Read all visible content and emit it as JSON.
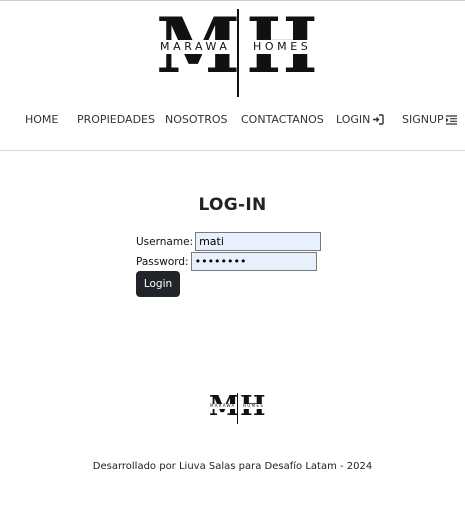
{
  "brand": {
    "monogram_left": "M",
    "monogram_right": "H",
    "word_left": "MARAWA",
    "word_right": "HOMES"
  },
  "nav": {
    "items": [
      {
        "label": "HOME"
      },
      {
        "label": "PROPIEDADES"
      },
      {
        "label": "NOSOTROS"
      },
      {
        "label": "CONTACTANOS"
      },
      {
        "label": "LOGIN",
        "icon": "login-icon"
      },
      {
        "label": "SIGNUP",
        "icon": "list-indent-icon"
      }
    ]
  },
  "login": {
    "title": "LOG-IN",
    "username_label": "Username:",
    "username_value": "mati",
    "password_label": "Password:",
    "password_value": "••••••••",
    "submit_label": "Login"
  },
  "footer": {
    "credit": "Desarrollado por Liuva Salas para Desafío Latam - 2024"
  },
  "colors": {
    "button_bg": "#212529",
    "input_bg": "#e8f0fe",
    "text": "#222222"
  }
}
